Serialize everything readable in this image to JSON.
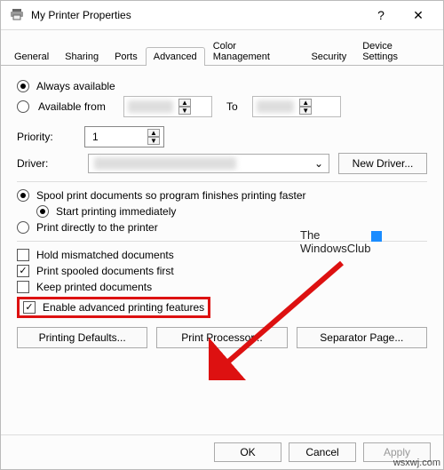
{
  "window": {
    "title": "My Printer Properties"
  },
  "tabs": [
    "General",
    "Sharing",
    "Ports",
    "Advanced",
    "Color Management",
    "Security",
    "Device Settings"
  ],
  "active_tab": "Advanced",
  "availability": {
    "always_label": "Always available",
    "from_label": "Available from",
    "to_label": "To",
    "from_value": "██████",
    "to_value": "█████"
  },
  "priority": {
    "label": "Priority:",
    "value": "1"
  },
  "driver": {
    "label": "Driver:",
    "value": "████████████████",
    "new_driver_btn": "New Driver..."
  },
  "spool": {
    "spool_label": "Spool print documents so program finishes printing faster",
    "start_immediately_label": "Start printing immediately",
    "direct_label": "Print directly to the printer"
  },
  "options": {
    "hold_mismatched": "Hold mismatched documents",
    "print_spooled_first": "Print spooled documents first",
    "keep_printed": "Keep printed documents",
    "enable_advanced": "Enable advanced printing features"
  },
  "buttons": {
    "printing_defaults": "Printing Defaults...",
    "print_processor": "Print Processor...",
    "separator_page": "Separator Page...",
    "ok": "OK",
    "cancel": "Cancel",
    "apply": "Apply"
  },
  "annotation": {
    "line1": "The",
    "line2": "WindowsClub"
  },
  "watermark": "wsxwj.com"
}
